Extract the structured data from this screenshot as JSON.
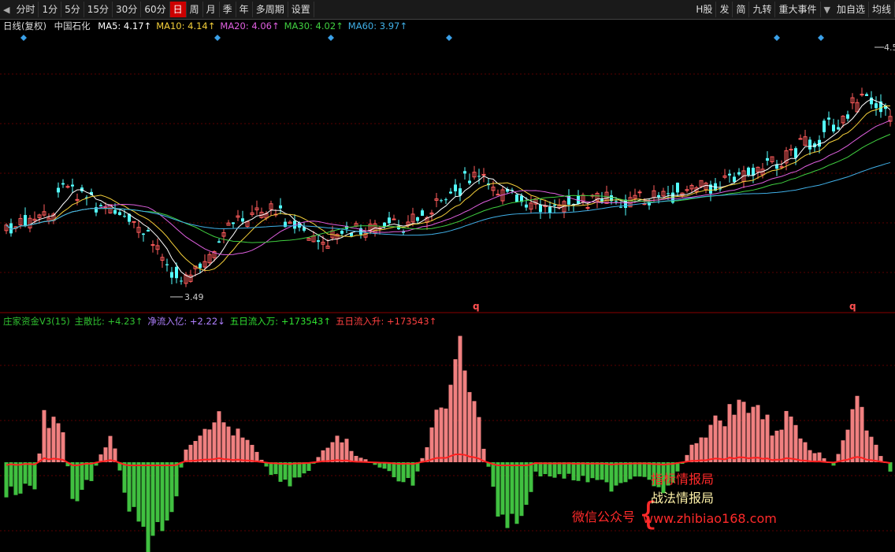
{
  "toolbar": {
    "left_items": [
      "分时",
      "1分",
      "5分",
      "15分",
      "30分",
      "60分",
      "日",
      "周",
      "月",
      "季",
      "年",
      "多周期",
      "设置"
    ],
    "active": "日",
    "right_items": [
      "H股",
      "发",
      "简",
      "九转",
      "重大事件",
      "加自选",
      "均线"
    ]
  },
  "header": {
    "period": "日线(复权)",
    "stock": "中国石化",
    "ma": [
      {
        "label": "MA5: 4.17↑",
        "color": "#ffffff"
      },
      {
        "label": "MA10: 4.14↑",
        "color": "#f5d03a"
      },
      {
        "label": "MA20: 4.06↑",
        "color": "#e060e0"
      },
      {
        "label": "MA30: 4.02↑",
        "color": "#40d040"
      },
      {
        "label": "MA60: 3.97↑",
        "color": "#40b0e8"
      }
    ]
  },
  "indicator": {
    "name": "庄家资金V3(15)",
    "items": [
      {
        "label": "主散比: +4.23↑",
        "color": "#30c030"
      },
      {
        "label": "净流入亿: +2.22↓",
        "color": "#b080ff"
      },
      {
        "label": "五日流入万: +173543↑",
        "color": "#30e030"
      },
      {
        "label": "五日流入升: +173543↑",
        "color": "#ff4040"
      }
    ]
  },
  "annotations": {
    "low_label": "3.49",
    "high_label": "4.5",
    "q1": "q",
    "q2": "q"
  },
  "watermark": {
    "left": "微信公众号",
    "line1": "指标情报局",
    "line2": "战法情报局",
    "url": "www.zhibiao168.com"
  },
  "colors": {
    "up": "#ff5c5c",
    "down": "#54ffff",
    "bar_pos": "#f08080",
    "bar_neg": "#40c040",
    "grid": "#5a0000"
  },
  "chart_data": {
    "type": "candlestick",
    "ohlc": [],
    "volume_bars": []
  }
}
